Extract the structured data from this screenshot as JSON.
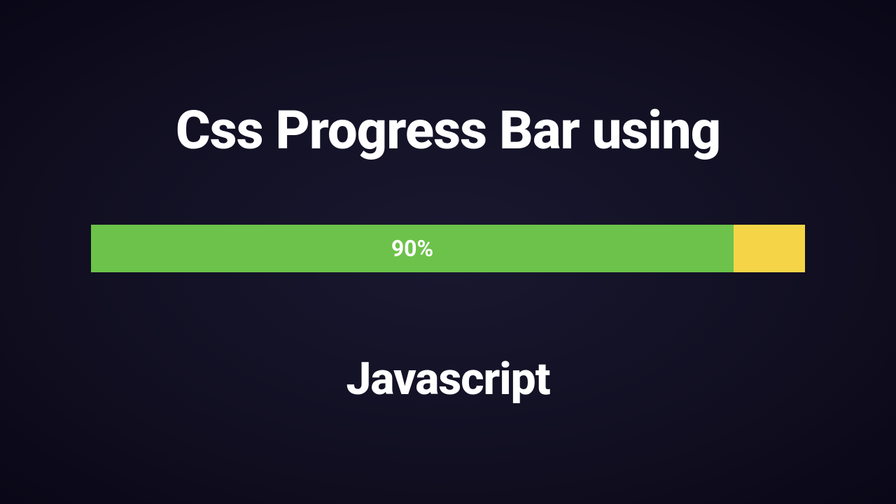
{
  "title_line1": "Css Progress Bar using",
  "title_line2": "Javascript",
  "progress": {
    "percent": 90,
    "label": "90%",
    "fill_color": "#6cc24a",
    "track_color": "#f5d547"
  }
}
